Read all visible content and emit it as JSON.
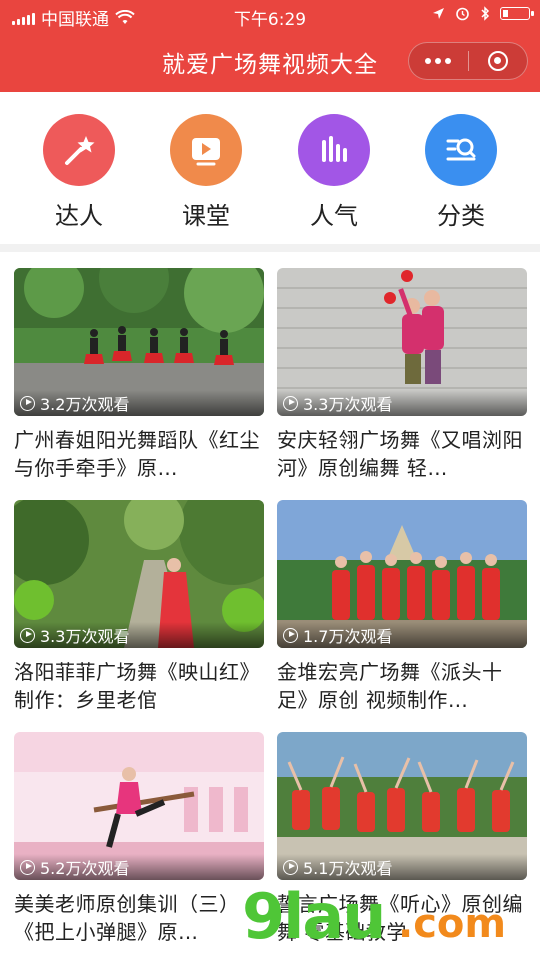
{
  "status_bar": {
    "carrier": "中国联通",
    "time": "下午6:29"
  },
  "nav": {
    "title": "就爱广场舞视频大全"
  },
  "categories": [
    {
      "label": "达人",
      "icon": "magic-wand-icon",
      "color": "#ee5a5a"
    },
    {
      "label": "课堂",
      "icon": "video-class-icon",
      "color": "#f08a4b"
    },
    {
      "label": "人气",
      "icon": "bars-icon",
      "color": "#a256e6"
    },
    {
      "label": "分类",
      "icon": "search-list-icon",
      "color": "#3a8ff0"
    }
  ],
  "videos": [
    {
      "views": "3.2万次观看",
      "title": "广州春姐阳光舞蹈队《红尘与你手牵手》原…"
    },
    {
      "views": "3.3万次观看",
      "title": "安庆轻翎广场舞《又唱浏阳河》原创编舞 轻…"
    },
    {
      "views": "3.3万次观看",
      "title": "洛阳菲菲广场舞《映山红》制作：乡里老倌"
    },
    {
      "views": "1.7万次观看",
      "title": "金堆宏亮广场舞《派头十足》原创 视频制作…"
    },
    {
      "views": "5.2万次观看",
      "title": "美美老师原创集训（三）《把上小弹腿》原…"
    },
    {
      "views": "5.1万次观看",
      "title": "誓言广场舞《听心》原创编舞 零基础教学"
    }
  ],
  "watermark": {
    "brand": "9lau",
    "suffix": ".com",
    "colors": {
      "brand": "#4fc637",
      "suffix": "#f28a1c"
    }
  },
  "colors": {
    "theme": "#e9453f"
  }
}
